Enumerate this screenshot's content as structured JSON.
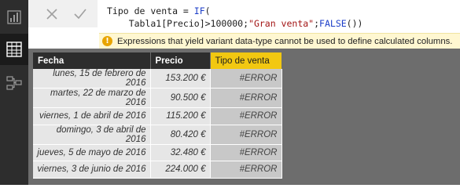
{
  "sidebar": {
    "items": [
      {
        "name": "report-view",
        "icon": "bar-chart-icon"
      },
      {
        "name": "data-view",
        "icon": "table-grid-icon",
        "active": true
      },
      {
        "name": "relationships-view",
        "icon": "relationships-icon"
      }
    ],
    "accent_color": "#f2c811"
  },
  "formula_bar": {
    "line1_a": "Tipo de venta = ",
    "line1_fn": "IF",
    "line1_b": "(",
    "line2_a": "    Tabla1[Precio]>100000;",
    "line2_str": "\"Gran venta\"",
    "line2_b": ";",
    "line2_kw": "FALSE",
    "line2_c": "())",
    "error_message": "Expressions that yield variant data-type cannot be used to define calculated columns."
  },
  "table": {
    "columns": [
      "Fecha",
      "Precio",
      "Tipo de venta"
    ],
    "selected_column": "Tipo de venta",
    "rows": [
      [
        "lunes, 15 de febrero de 2016",
        "153.200 €",
        "#ERROR"
      ],
      [
        "martes, 22 de marzo de 2016",
        "90.500 €",
        "#ERROR"
      ],
      [
        "viernes, 1 de abril de 2016",
        "115.200 €",
        "#ERROR"
      ],
      [
        "domingo, 3 de abril de 2016",
        "80.420 €",
        "#ERROR"
      ],
      [
        "jueves, 5 de mayo de 2016",
        "32.480 €",
        "#ERROR"
      ],
      [
        "viernes, 3 de junio de 2016",
        "224.000 €",
        "#ERROR"
      ]
    ]
  }
}
